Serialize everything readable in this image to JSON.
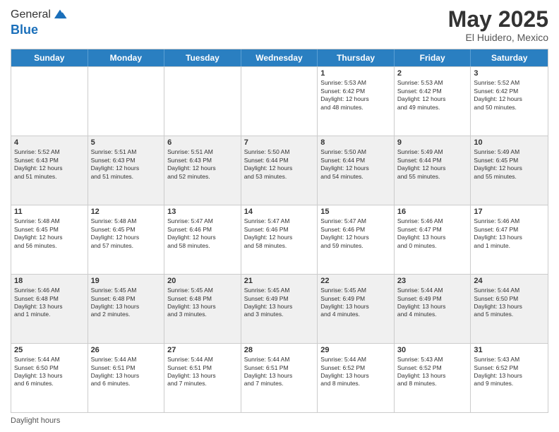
{
  "logo": {
    "general": "General",
    "blue": "Blue"
  },
  "title": "May 2025",
  "location": "El Huidero, Mexico",
  "days_of_week": [
    "Sunday",
    "Monday",
    "Tuesday",
    "Wednesday",
    "Thursday",
    "Friday",
    "Saturday"
  ],
  "footer": "Daylight hours",
  "weeks": [
    [
      {
        "day": "",
        "info": ""
      },
      {
        "day": "",
        "info": ""
      },
      {
        "day": "",
        "info": ""
      },
      {
        "day": "",
        "info": ""
      },
      {
        "day": "1",
        "info": "Sunrise: 5:53 AM\nSunset: 6:42 PM\nDaylight: 12 hours\nand 48 minutes."
      },
      {
        "day": "2",
        "info": "Sunrise: 5:53 AM\nSunset: 6:42 PM\nDaylight: 12 hours\nand 49 minutes."
      },
      {
        "day": "3",
        "info": "Sunrise: 5:52 AM\nSunset: 6:42 PM\nDaylight: 12 hours\nand 50 minutes."
      }
    ],
    [
      {
        "day": "4",
        "info": "Sunrise: 5:52 AM\nSunset: 6:43 PM\nDaylight: 12 hours\nand 51 minutes."
      },
      {
        "day": "5",
        "info": "Sunrise: 5:51 AM\nSunset: 6:43 PM\nDaylight: 12 hours\nand 51 minutes."
      },
      {
        "day": "6",
        "info": "Sunrise: 5:51 AM\nSunset: 6:43 PM\nDaylight: 12 hours\nand 52 minutes."
      },
      {
        "day": "7",
        "info": "Sunrise: 5:50 AM\nSunset: 6:44 PM\nDaylight: 12 hours\nand 53 minutes."
      },
      {
        "day": "8",
        "info": "Sunrise: 5:50 AM\nSunset: 6:44 PM\nDaylight: 12 hours\nand 54 minutes."
      },
      {
        "day": "9",
        "info": "Sunrise: 5:49 AM\nSunset: 6:44 PM\nDaylight: 12 hours\nand 55 minutes."
      },
      {
        "day": "10",
        "info": "Sunrise: 5:49 AM\nSunset: 6:45 PM\nDaylight: 12 hours\nand 55 minutes."
      }
    ],
    [
      {
        "day": "11",
        "info": "Sunrise: 5:48 AM\nSunset: 6:45 PM\nDaylight: 12 hours\nand 56 minutes."
      },
      {
        "day": "12",
        "info": "Sunrise: 5:48 AM\nSunset: 6:45 PM\nDaylight: 12 hours\nand 57 minutes."
      },
      {
        "day": "13",
        "info": "Sunrise: 5:47 AM\nSunset: 6:46 PM\nDaylight: 12 hours\nand 58 minutes."
      },
      {
        "day": "14",
        "info": "Sunrise: 5:47 AM\nSunset: 6:46 PM\nDaylight: 12 hours\nand 58 minutes."
      },
      {
        "day": "15",
        "info": "Sunrise: 5:47 AM\nSunset: 6:46 PM\nDaylight: 12 hours\nand 59 minutes."
      },
      {
        "day": "16",
        "info": "Sunrise: 5:46 AM\nSunset: 6:47 PM\nDaylight: 13 hours\nand 0 minutes."
      },
      {
        "day": "17",
        "info": "Sunrise: 5:46 AM\nSunset: 6:47 PM\nDaylight: 13 hours\nand 1 minute."
      }
    ],
    [
      {
        "day": "18",
        "info": "Sunrise: 5:46 AM\nSunset: 6:48 PM\nDaylight: 13 hours\nand 1 minute."
      },
      {
        "day": "19",
        "info": "Sunrise: 5:45 AM\nSunset: 6:48 PM\nDaylight: 13 hours\nand 2 minutes."
      },
      {
        "day": "20",
        "info": "Sunrise: 5:45 AM\nSunset: 6:48 PM\nDaylight: 13 hours\nand 3 minutes."
      },
      {
        "day": "21",
        "info": "Sunrise: 5:45 AM\nSunset: 6:49 PM\nDaylight: 13 hours\nand 3 minutes."
      },
      {
        "day": "22",
        "info": "Sunrise: 5:45 AM\nSunset: 6:49 PM\nDaylight: 13 hours\nand 4 minutes."
      },
      {
        "day": "23",
        "info": "Sunrise: 5:44 AM\nSunset: 6:49 PM\nDaylight: 13 hours\nand 4 minutes."
      },
      {
        "day": "24",
        "info": "Sunrise: 5:44 AM\nSunset: 6:50 PM\nDaylight: 13 hours\nand 5 minutes."
      }
    ],
    [
      {
        "day": "25",
        "info": "Sunrise: 5:44 AM\nSunset: 6:50 PM\nDaylight: 13 hours\nand 6 minutes."
      },
      {
        "day": "26",
        "info": "Sunrise: 5:44 AM\nSunset: 6:51 PM\nDaylight: 13 hours\nand 6 minutes."
      },
      {
        "day": "27",
        "info": "Sunrise: 5:44 AM\nSunset: 6:51 PM\nDaylight: 13 hours\nand 7 minutes."
      },
      {
        "day": "28",
        "info": "Sunrise: 5:44 AM\nSunset: 6:51 PM\nDaylight: 13 hours\nand 7 minutes."
      },
      {
        "day": "29",
        "info": "Sunrise: 5:44 AM\nSunset: 6:52 PM\nDaylight: 13 hours\nand 8 minutes."
      },
      {
        "day": "30",
        "info": "Sunrise: 5:43 AM\nSunset: 6:52 PM\nDaylight: 13 hours\nand 8 minutes."
      },
      {
        "day": "31",
        "info": "Sunrise: 5:43 AM\nSunset: 6:52 PM\nDaylight: 13 hours\nand 9 minutes."
      }
    ]
  ]
}
